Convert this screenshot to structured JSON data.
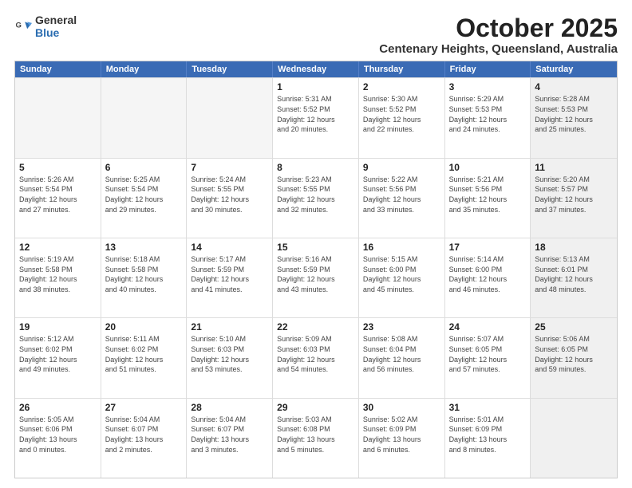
{
  "logo": {
    "general": "General",
    "blue": "Blue"
  },
  "header": {
    "title": "October 2025",
    "subtitle": "Centenary Heights, Queensland, Australia"
  },
  "weekdays": [
    "Sunday",
    "Monday",
    "Tuesday",
    "Wednesday",
    "Thursday",
    "Friday",
    "Saturday"
  ],
  "rows": [
    [
      {
        "day": "",
        "lines": [],
        "empty": true
      },
      {
        "day": "",
        "lines": [],
        "empty": true
      },
      {
        "day": "",
        "lines": [],
        "empty": true
      },
      {
        "day": "1",
        "lines": [
          "Sunrise: 5:31 AM",
          "Sunset: 5:52 PM",
          "Daylight: 12 hours",
          "and 20 minutes."
        ],
        "empty": false
      },
      {
        "day": "2",
        "lines": [
          "Sunrise: 5:30 AM",
          "Sunset: 5:52 PM",
          "Daylight: 12 hours",
          "and 22 minutes."
        ],
        "empty": false
      },
      {
        "day": "3",
        "lines": [
          "Sunrise: 5:29 AM",
          "Sunset: 5:53 PM",
          "Daylight: 12 hours",
          "and 24 minutes."
        ],
        "empty": false
      },
      {
        "day": "4",
        "lines": [
          "Sunrise: 5:28 AM",
          "Sunset: 5:53 PM",
          "Daylight: 12 hours",
          "and 25 minutes."
        ],
        "empty": false,
        "shaded": true
      }
    ],
    [
      {
        "day": "5",
        "lines": [
          "Sunrise: 5:26 AM",
          "Sunset: 5:54 PM",
          "Daylight: 12 hours",
          "and 27 minutes."
        ],
        "empty": false
      },
      {
        "day": "6",
        "lines": [
          "Sunrise: 5:25 AM",
          "Sunset: 5:54 PM",
          "Daylight: 12 hours",
          "and 29 minutes."
        ],
        "empty": false
      },
      {
        "day": "7",
        "lines": [
          "Sunrise: 5:24 AM",
          "Sunset: 5:55 PM",
          "Daylight: 12 hours",
          "and 30 minutes."
        ],
        "empty": false
      },
      {
        "day": "8",
        "lines": [
          "Sunrise: 5:23 AM",
          "Sunset: 5:55 PM",
          "Daylight: 12 hours",
          "and 32 minutes."
        ],
        "empty": false
      },
      {
        "day": "9",
        "lines": [
          "Sunrise: 5:22 AM",
          "Sunset: 5:56 PM",
          "Daylight: 12 hours",
          "and 33 minutes."
        ],
        "empty": false
      },
      {
        "day": "10",
        "lines": [
          "Sunrise: 5:21 AM",
          "Sunset: 5:56 PM",
          "Daylight: 12 hours",
          "and 35 minutes."
        ],
        "empty": false
      },
      {
        "day": "11",
        "lines": [
          "Sunrise: 5:20 AM",
          "Sunset: 5:57 PM",
          "Daylight: 12 hours",
          "and 37 minutes."
        ],
        "empty": false,
        "shaded": true
      }
    ],
    [
      {
        "day": "12",
        "lines": [
          "Sunrise: 5:19 AM",
          "Sunset: 5:58 PM",
          "Daylight: 12 hours",
          "and 38 minutes."
        ],
        "empty": false
      },
      {
        "day": "13",
        "lines": [
          "Sunrise: 5:18 AM",
          "Sunset: 5:58 PM",
          "Daylight: 12 hours",
          "and 40 minutes."
        ],
        "empty": false
      },
      {
        "day": "14",
        "lines": [
          "Sunrise: 5:17 AM",
          "Sunset: 5:59 PM",
          "Daylight: 12 hours",
          "and 41 minutes."
        ],
        "empty": false
      },
      {
        "day": "15",
        "lines": [
          "Sunrise: 5:16 AM",
          "Sunset: 5:59 PM",
          "Daylight: 12 hours",
          "and 43 minutes."
        ],
        "empty": false
      },
      {
        "day": "16",
        "lines": [
          "Sunrise: 5:15 AM",
          "Sunset: 6:00 PM",
          "Daylight: 12 hours",
          "and 45 minutes."
        ],
        "empty": false
      },
      {
        "day": "17",
        "lines": [
          "Sunrise: 5:14 AM",
          "Sunset: 6:00 PM",
          "Daylight: 12 hours",
          "and 46 minutes."
        ],
        "empty": false
      },
      {
        "day": "18",
        "lines": [
          "Sunrise: 5:13 AM",
          "Sunset: 6:01 PM",
          "Daylight: 12 hours",
          "and 48 minutes."
        ],
        "empty": false,
        "shaded": true
      }
    ],
    [
      {
        "day": "19",
        "lines": [
          "Sunrise: 5:12 AM",
          "Sunset: 6:02 PM",
          "Daylight: 12 hours",
          "and 49 minutes."
        ],
        "empty": false
      },
      {
        "day": "20",
        "lines": [
          "Sunrise: 5:11 AM",
          "Sunset: 6:02 PM",
          "Daylight: 12 hours",
          "and 51 minutes."
        ],
        "empty": false
      },
      {
        "day": "21",
        "lines": [
          "Sunrise: 5:10 AM",
          "Sunset: 6:03 PM",
          "Daylight: 12 hours",
          "and 53 minutes."
        ],
        "empty": false
      },
      {
        "day": "22",
        "lines": [
          "Sunrise: 5:09 AM",
          "Sunset: 6:03 PM",
          "Daylight: 12 hours",
          "and 54 minutes."
        ],
        "empty": false
      },
      {
        "day": "23",
        "lines": [
          "Sunrise: 5:08 AM",
          "Sunset: 6:04 PM",
          "Daylight: 12 hours",
          "and 56 minutes."
        ],
        "empty": false
      },
      {
        "day": "24",
        "lines": [
          "Sunrise: 5:07 AM",
          "Sunset: 6:05 PM",
          "Daylight: 12 hours",
          "and 57 minutes."
        ],
        "empty": false
      },
      {
        "day": "25",
        "lines": [
          "Sunrise: 5:06 AM",
          "Sunset: 6:05 PM",
          "Daylight: 12 hours",
          "and 59 minutes."
        ],
        "empty": false,
        "shaded": true
      }
    ],
    [
      {
        "day": "26",
        "lines": [
          "Sunrise: 5:05 AM",
          "Sunset: 6:06 PM",
          "Daylight: 13 hours",
          "and 0 minutes."
        ],
        "empty": false
      },
      {
        "day": "27",
        "lines": [
          "Sunrise: 5:04 AM",
          "Sunset: 6:07 PM",
          "Daylight: 13 hours",
          "and 2 minutes."
        ],
        "empty": false
      },
      {
        "day": "28",
        "lines": [
          "Sunrise: 5:04 AM",
          "Sunset: 6:07 PM",
          "Daylight: 13 hours",
          "and 3 minutes."
        ],
        "empty": false
      },
      {
        "day": "29",
        "lines": [
          "Sunrise: 5:03 AM",
          "Sunset: 6:08 PM",
          "Daylight: 13 hours",
          "and 5 minutes."
        ],
        "empty": false
      },
      {
        "day": "30",
        "lines": [
          "Sunrise: 5:02 AM",
          "Sunset: 6:09 PM",
          "Daylight: 13 hours",
          "and 6 minutes."
        ],
        "empty": false
      },
      {
        "day": "31",
        "lines": [
          "Sunrise: 5:01 AM",
          "Sunset: 6:09 PM",
          "Daylight: 13 hours",
          "and 8 minutes."
        ],
        "empty": false
      },
      {
        "day": "",
        "lines": [],
        "empty": true,
        "shaded": true
      }
    ]
  ]
}
